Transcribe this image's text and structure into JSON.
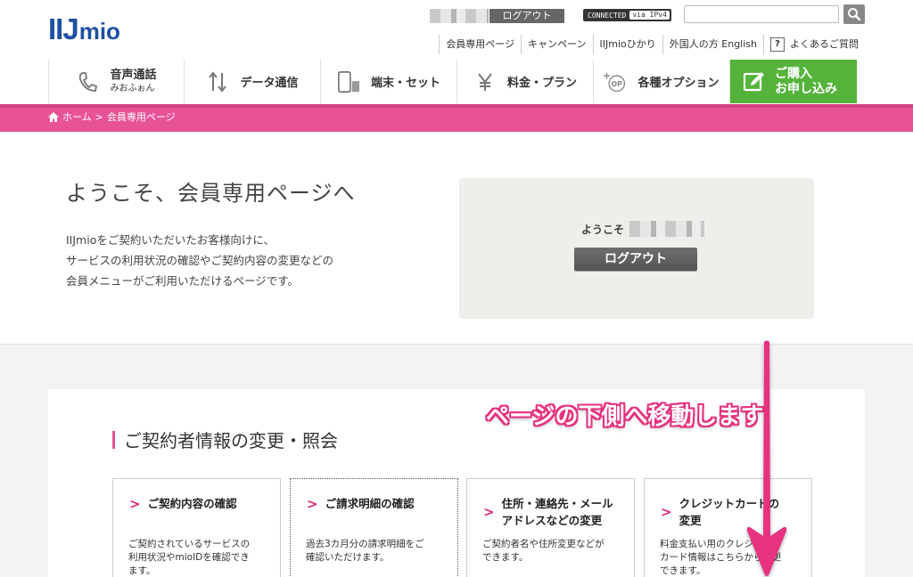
{
  "header": {
    "logo_main": "IIJ",
    "logo_sub": "mio",
    "logout_small": "ログアウト",
    "connected": "CONNECTED",
    "via": "via IPv4",
    "search_value": "",
    "search_placeholder": ""
  },
  "sublinks": [
    {
      "label": "会員専用ページ"
    },
    {
      "label": "キャンペーン"
    },
    {
      "label": "IIJmioひかり"
    },
    {
      "label": "外国人の方 English"
    },
    {
      "label": "よくあるご質問"
    }
  ],
  "gnav": {
    "voice_label": "音声通話",
    "voice_sub": "みおふぉん",
    "data": "データ通信",
    "device": "端末・セット",
    "price": "料金・プラン",
    "options": "各種オプション",
    "apply_line1": "ご購入",
    "apply_line2": "お申し込み",
    "op_badge": "OP"
  },
  "breadcrumb": {
    "home": "ホーム",
    "sep": ">",
    "current": "会員専用ページ"
  },
  "welcome": {
    "title": "ようこそ、会員専用ページへ",
    "line1": "IIJmioをご契約いただいたお客様向けに、",
    "line2": "サービスの利用状況の確認やご契約内容の変更などの",
    "line3": "会員メニューがご利用いただけるページです。",
    "greet": "ようこそ",
    "logout": "ログアウト"
  },
  "section": {
    "title": "ご契約者情報の変更・照会"
  },
  "cards": [
    {
      "title1": "ご契約内容の確認",
      "title2": "",
      "desc1": "ご契約されているサービスの",
      "desc2": "利用状況やmioIDを確認でき",
      "desc3": "ます。"
    },
    {
      "title1": "ご請求明細の確認",
      "title2": "",
      "desc1": "過去3カ月分の請求明細をご",
      "desc2": "確認いただけます。",
      "desc3": ""
    },
    {
      "title1": "住所・連絡先・メール",
      "title2": "アドレスなどの変更",
      "desc1": "ご契約者名や住所変更などが",
      "desc2": "できます。",
      "desc3": ""
    },
    {
      "title1": "クレジットカードの",
      "title2": "変更",
      "desc1": "料金支払い用のクレジット",
      "desc2": "カード情報はこちらから変更",
      "desc3": "できます。"
    }
  ],
  "annotation": {
    "text": "ページの下側へ移動します"
  },
  "colors": {
    "brand_blue": "#1d4fa3",
    "pink": "#e85396",
    "green": "#55b33b",
    "annotation": "#e6307f"
  }
}
